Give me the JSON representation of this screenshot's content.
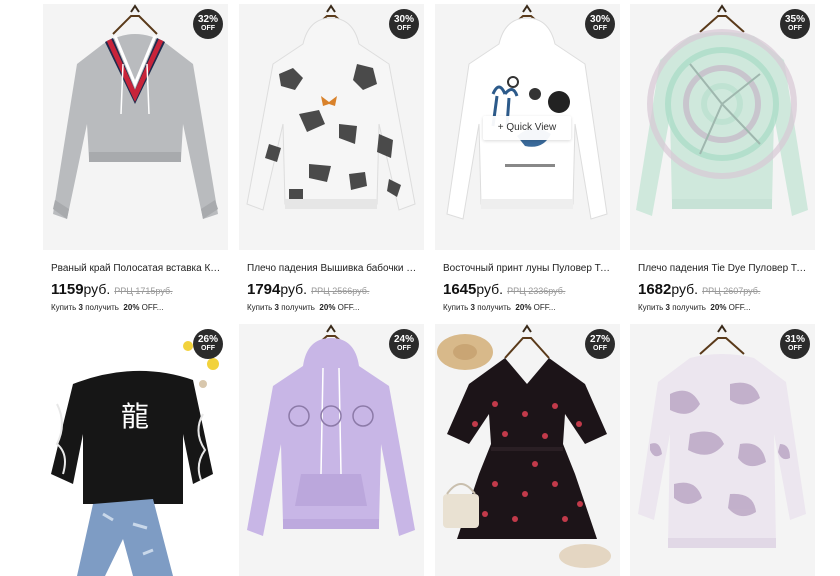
{
  "products": [
    {
      "title": "Рваный край Полосатая вставка Кор...",
      "price": "1159",
      "currency": "руб.",
      "old_price": "РРЦ 1715руб.",
      "discount": "32%",
      "off": "OFF",
      "promo": {
        "buy": "Купить",
        "n": "3",
        "get": "получить",
        "pct": "20%",
        "off": "OFF..."
      }
    },
    {
      "title": "Плечо падения Вышивка бабочки Tie...",
      "price": "1794",
      "currency": "руб.",
      "old_price": "РРЦ 2566руб.",
      "discount": "30%",
      "off": "OFF",
      "promo": {
        "buy": "Купить",
        "n": "3",
        "get": "получить",
        "pct": "20%",
        "off": "OFF..."
      }
    },
    {
      "title": "Восточный принт луны Пуловер Тол...",
      "price": "1645",
      "currency": "руб.",
      "old_price": "РРЦ 2336руб.",
      "discount": "30%",
      "off": "OFF",
      "quick_view": "+ Quick View",
      "promo": {
        "buy": "Купить",
        "n": "3",
        "get": "получить",
        "pct": "20%",
        "off": "OFF..."
      }
    },
    {
      "title": "Плечо падения Tie Dye Пуловер Тол...",
      "price": "1682",
      "currency": "руб.",
      "old_price": "РРЦ 2607руб.",
      "discount": "35%",
      "off": "OFF",
      "promo": {
        "buy": "Купить",
        "n": "3",
        "get": "получить",
        "pct": "20%",
        "off": "OFF..."
      }
    },
    {
      "discount": "26%",
      "off": "OFF",
      "glyph": "龍"
    },
    {
      "discount": "24%",
      "off": "OFF"
    },
    {
      "discount": "27%",
      "off": "OFF"
    },
    {
      "discount": "31%",
      "off": "OFF"
    }
  ],
  "colors": {
    "badge": "#2b2b2b",
    "image_bg": "#f2f2f2"
  }
}
